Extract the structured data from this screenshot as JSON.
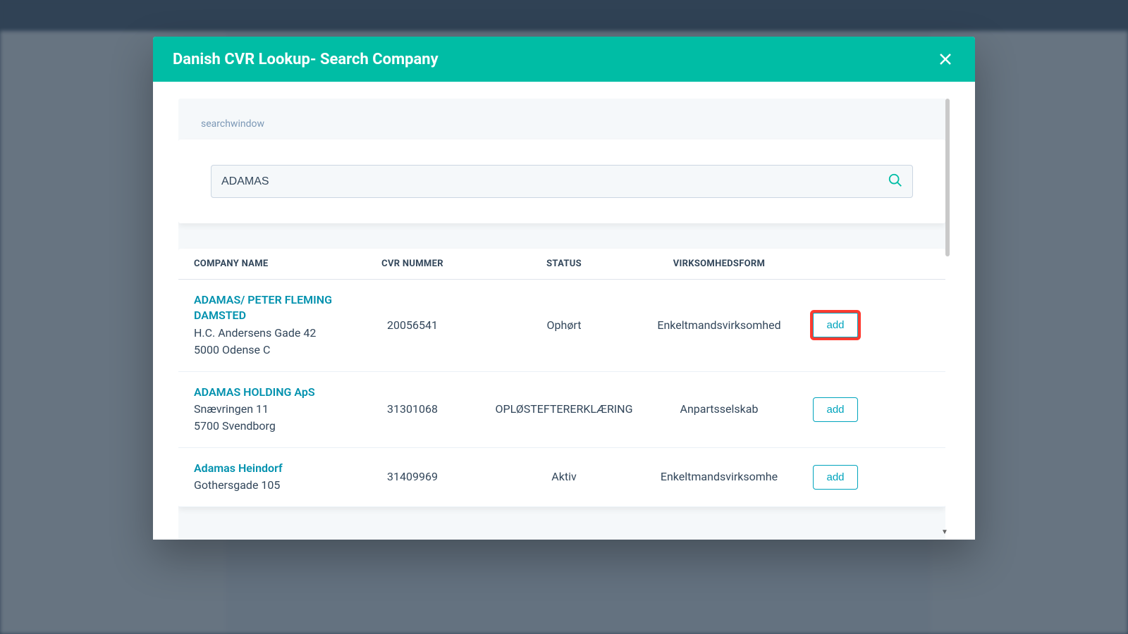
{
  "modal": {
    "title": "Danish CVR Lookup- Search Company"
  },
  "search": {
    "label": "searchwindow",
    "value": "ADAMAS"
  },
  "table": {
    "headers": {
      "company": "COMPANY NAME",
      "cvr": "CVR NUMMER",
      "status": "STATUS",
      "form": "VIRKSOMHEDSFORM"
    },
    "add_label": "add",
    "rows": [
      {
        "name": "ADAMAS/ PETER FLEMING DAMSTED",
        "address_line1": "H.C. Andersens Gade 42",
        "address_line2": "5000 Odense C",
        "cvr": "20056541",
        "status": "Ophørt",
        "form": "Enkeltmandsvirksomhed",
        "highlighted": true
      },
      {
        "name": "ADAMAS HOLDING ApS",
        "address_line1": "Snævringen 11",
        "address_line2": "5700 Svendborg",
        "cvr": "31301068",
        "status": "OPLØSTEFTERERKLÆRING",
        "form": "Anpartsselskab",
        "highlighted": false
      },
      {
        "name": "Adamas Heindorf",
        "address_line1": "Gothersgade 105",
        "address_line2": "",
        "cvr": "31409969",
        "status": "Aktiv",
        "form": "Enkeltmandsvirksomhe",
        "highlighted": false
      }
    ]
  }
}
